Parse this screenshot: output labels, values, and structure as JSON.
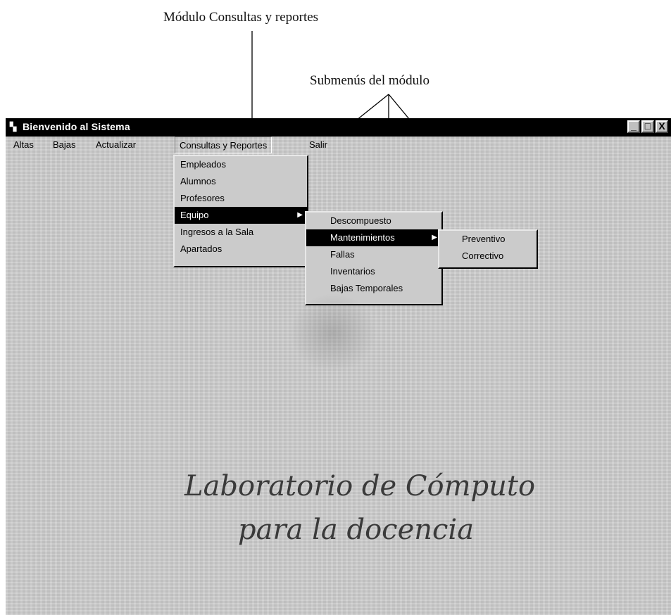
{
  "annotations": {
    "module_label": "Módulo Consultas y reportes",
    "submenus_label": "Submenús del módulo"
  },
  "window": {
    "title": "Bienvenido al Sistema",
    "app_icon": "app-icon",
    "title_buttons": {
      "minimize": "_",
      "maximize": "□",
      "close": "X"
    }
  },
  "menubar": {
    "items": [
      {
        "label": "Altas",
        "mnemonic": "A"
      },
      {
        "label": "Bajas",
        "mnemonic": "B"
      },
      {
        "label": "Actualizar",
        "mnemonic": "c"
      },
      {
        "label": "Consultas y Reportes",
        "mnemonic": "R",
        "active": true
      },
      {
        "label": "Salir",
        "mnemonic": "S"
      }
    ]
  },
  "consultas_menu": {
    "items": [
      {
        "label": "Empleados",
        "mnemonic": "E"
      },
      {
        "label": "Alumnos",
        "mnemonic": "A"
      },
      {
        "label": "Profesores",
        "mnemonic": "P"
      },
      {
        "label": "Equipo",
        "mnemonic": "q",
        "selected": true,
        "has_submenu": true
      },
      {
        "label": "Ingresos a la Sala",
        "mnemonic": "I"
      },
      {
        "label": "Apartados",
        "mnemonic": "r"
      }
    ]
  },
  "equipo_menu": {
    "items": [
      {
        "label": "Descompuesto",
        "mnemonic": "D"
      },
      {
        "label": "Mantenimientos",
        "mnemonic": "M",
        "selected": true,
        "has_submenu": true
      },
      {
        "label": "Fallas",
        "mnemonic": "F"
      },
      {
        "label": "Inventarios",
        "mnemonic": "I"
      },
      {
        "label": "Bajas Temporales",
        "mnemonic": "B"
      }
    ]
  },
  "mantenimientos_menu": {
    "items": [
      {
        "label": "Preventivo",
        "mnemonic": "P"
      },
      {
        "label": "Correctivo",
        "mnemonic": "C"
      }
    ]
  },
  "background": {
    "line1": "Laboratorio de Cómputo",
    "line2": "para la docencia"
  }
}
